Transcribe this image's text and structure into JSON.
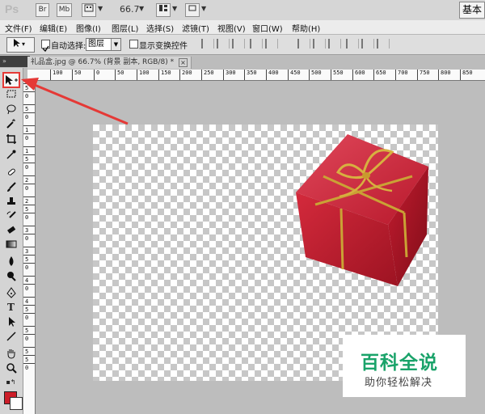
{
  "app": {
    "logo": "Ps",
    "br_button": "Br",
    "mb_button": "Mb",
    "zoom": "66.7",
    "workspace": "基本"
  },
  "menu": [
    "文件(F)",
    "编辑(E)",
    "图像(I)",
    "图层(L)",
    "选择(S)",
    "滤镜(T)",
    "视图(V)",
    "窗口(W)",
    "帮助(H)"
  ],
  "options": {
    "auto_select_label": "自动选择:",
    "auto_select_value": "图层",
    "show_transform_label": "显示变换控件"
  },
  "document": {
    "tab_title": "礼品盒.jpg @ 66.7% (背景 副本, RGB/8) *",
    "close": "×"
  },
  "ruler": {
    "top_labels": [
      "100",
      "50",
      "0",
      "50",
      "100",
      "150",
      "200",
      "250",
      "300",
      "350",
      "400",
      "450",
      "500",
      "550",
      "600",
      "650",
      "700",
      "750",
      "800",
      "850"
    ],
    "left_labels": [
      "5",
      "0",
      "5",
      "0",
      "1",
      "0",
      "1",
      "5",
      "0",
      "2",
      "0",
      "2",
      "5",
      "0",
      "3",
      "0",
      "3",
      "5",
      "0",
      "4",
      "0",
      "4",
      "5",
      "0",
      "5",
      "0",
      "5",
      "5",
      "0"
    ]
  },
  "toolbar": {
    "icons": [
      "move-tool-icon",
      "marquee-tool-icon",
      "lasso-tool-icon",
      "magic-wand-tool-icon",
      "crop-tool-icon",
      "eyedropper-tool-icon",
      "healing-brush-tool-icon",
      "brush-tool-icon",
      "clone-stamp-tool-icon",
      "history-brush-tool-icon",
      "eraser-tool-icon",
      "gradient-tool-icon",
      "blur-tool-icon",
      "dodge-tool-icon",
      "pen-tool-icon",
      "type-tool-icon",
      "path-selection-tool-icon",
      "line-tool-icon",
      "hand-tool-icon",
      "zoom-tool-icon"
    ],
    "type_glyph": "T"
  },
  "colors": {
    "foreground": "#cc1d28",
    "background": "#ffffff",
    "highlight": "#e53936",
    "watermark_title": "#1aa36a"
  },
  "watermark": {
    "line1": "百科全说",
    "line2": "助你轻松解决"
  }
}
